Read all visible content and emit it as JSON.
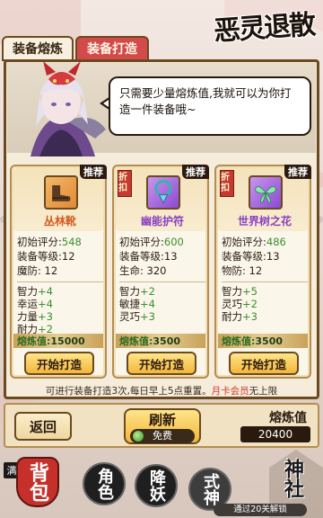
{
  "header": {
    "tabs": [
      {
        "label": "装备熔炼",
        "active": false
      },
      {
        "label": "装备打造",
        "active": true
      }
    ],
    "logo": "恶灵退散"
  },
  "npc": {
    "speech": "只需要少量熔炼值,我就可以为你打造一件装备哦~"
  },
  "cards": [
    {
      "badge": "推荐",
      "discount": null,
      "name": "丛林靴",
      "name_color": "#d35a1f",
      "quality": "orange",
      "icon": "boots-icon",
      "stats": [
        {
          "label": "初始评分:",
          "value": "548"
        },
        {
          "label": "装备等级:",
          "value": "12"
        },
        {
          "label": "魔防: ",
          "value": "12"
        }
      ],
      "gstats": [
        {
          "label": "智力",
          "value": "+4"
        },
        {
          "label": "幸运",
          "value": "+4"
        },
        {
          "label": "力量",
          "value": "+3"
        },
        {
          "label": "耐力",
          "value": "+2"
        }
      ],
      "cost_label": "熔炼值:",
      "cost": "15000",
      "button": "开始打造"
    },
    {
      "badge": "推荐",
      "discount": "折扣",
      "name": "幽能护符",
      "name_color": "#8a3fc2",
      "quality": "purple",
      "icon": "amulet-icon",
      "stats": [
        {
          "label": "初始评分:",
          "value": "600"
        },
        {
          "label": "装备等级:",
          "value": "13"
        },
        {
          "label": "生命: ",
          "value": "320"
        }
      ],
      "gstats": [
        {
          "label": "智力",
          "value": "+2"
        },
        {
          "label": "敏捷",
          "value": "+4"
        },
        {
          "label": "灵巧",
          "value": "+3"
        }
      ],
      "cost_label": "熔炼值:",
      "cost": "3500",
      "button": "开始打造"
    },
    {
      "badge": "推荐",
      "discount": "折扣",
      "name": "世界树之花",
      "name_color": "#8a3fc2",
      "quality": "purple",
      "icon": "flower-icon",
      "stats": [
        {
          "label": "初始评分:",
          "value": "486"
        },
        {
          "label": "装备等级:",
          "value": "13"
        },
        {
          "label": "物防: ",
          "value": "12"
        }
      ],
      "gstats": [
        {
          "label": "智力",
          "value": "+5"
        },
        {
          "label": "灵巧",
          "value": "+2"
        },
        {
          "label": "耐力",
          "value": "+3"
        }
      ],
      "cost_label": "熔炼值:",
      "cost": "3500",
      "button": "开始打造"
    }
  ],
  "notice": {
    "text": "可进行装备打造3次,每日早上5点重置。",
    "highlight": "月卡会员",
    "suffix": "无上限"
  },
  "footer": {
    "back": "返回",
    "refresh": "刷新",
    "refresh_cost": "免费",
    "forge_value_label": "熔炼值",
    "forge_value": "20400"
  },
  "nav": {
    "full_tag": "满",
    "bag": "背包",
    "role": "角色",
    "demon": "降妖",
    "shikigami": "式神",
    "shrine": "神社",
    "tip": "通过20关解锁"
  },
  "colors": {
    "accent_red": "#d24a4a",
    "gold": "#f3b63a",
    "green_value": "#3b8f2f",
    "border_brown": "#6b4a1f"
  }
}
